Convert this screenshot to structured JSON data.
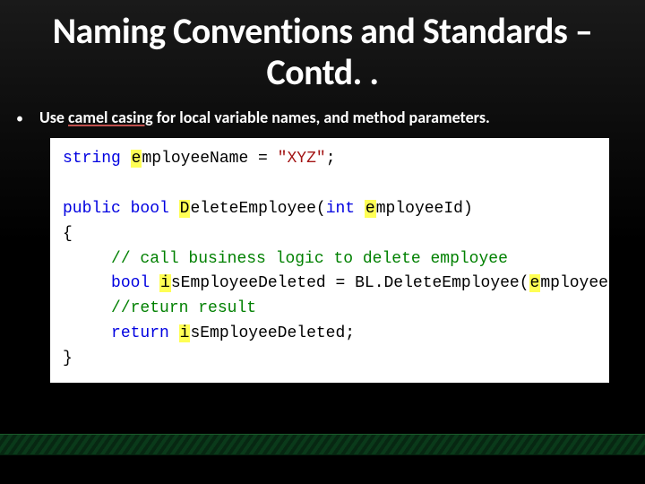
{
  "title": "Naming Conventions and Standards – Contd. .",
  "bullet": {
    "prefix": "Use ",
    "underlined": "camel casing",
    "suffix": " for local variable names, and method parameters."
  },
  "code": {
    "l1_kw": "string",
    "l1_var_h": "e",
    "l1_var_r": "mployeeName = ",
    "l1_str": "\"XYZ\"",
    "l1_end": ";",
    "l2": " ",
    "l3_kw1": "public",
    "l3_sp1": " ",
    "l3_kw2": "bool",
    "l3_sp2": " ",
    "l3_m_h": "D",
    "l3_m_r": "eleteEmployee(",
    "l3_kw3": "int",
    "l3_sp3": " ",
    "l3_p_h": "e",
    "l3_p_r": "mployeeId)",
    "l4": "{",
    "l5_indent": "     ",
    "l5_cmt": "// call business logic to delete employee",
    "l6_indent": "     ",
    "l6_kw": "bool",
    "l6_sp": " ",
    "l6_v_h": "i",
    "l6_v_r": "sEmployeeDeleted = BL.DeleteEmployee(",
    "l6_a_h": "e",
    "l6_a_r": "mployeeId",
    "l6_end": ");",
    "l7_indent": "     ",
    "l7_cmt": "//return result",
    "l8_indent": "     ",
    "l8_kw": "return",
    "l8_sp": " ",
    "l8_v_h": "i",
    "l8_v_r": "sEmployeeDeleted;",
    "l9": "}"
  }
}
